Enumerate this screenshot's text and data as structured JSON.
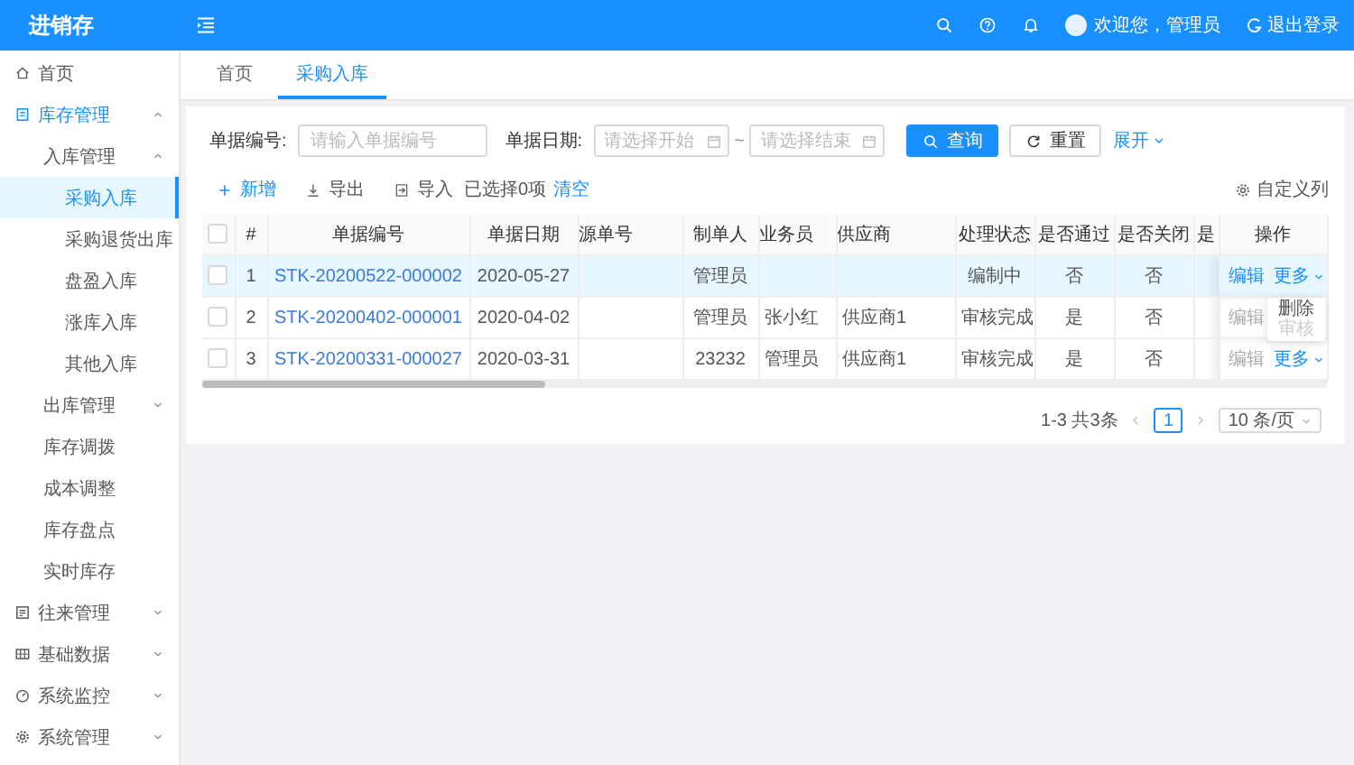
{
  "app": {
    "title": "进销存",
    "user": "欢迎您，管理员",
    "logout": "退出登录"
  },
  "sidebar": {
    "items": [
      {
        "label": "首页",
        "selected": false
      },
      {
        "label": "库存管理",
        "selected": false,
        "expanded": true,
        "children": [
          {
            "label": "入库管理",
            "selected": false,
            "expanded": true,
            "children": [
              {
                "label": "采购入库",
                "selected": true
              },
              {
                "label": "采购退货出库",
                "selected": false
              },
              {
                "label": "盘盈入库",
                "selected": false
              },
              {
                "label": "涨库入库",
                "selected": false
              },
              {
                "label": "其他入库",
                "selected": false
              }
            ]
          },
          {
            "label": "出库管理",
            "selected": false,
            "expanded": false
          },
          {
            "label": "库存调拨",
            "selected": false
          },
          {
            "label": "成本调整",
            "selected": false
          },
          {
            "label": "库存盘点",
            "selected": false
          },
          {
            "label": "实时库存",
            "selected": false
          }
        ]
      },
      {
        "label": "往来管理",
        "selected": false,
        "expanded": false
      },
      {
        "label": "基础数据",
        "selected": false,
        "expanded": false
      },
      {
        "label": "系统监控",
        "selected": false,
        "expanded": false
      },
      {
        "label": "系统管理",
        "selected": false,
        "expanded": false
      }
    ]
  },
  "tabs": [
    {
      "label": "首页",
      "selected": false
    },
    {
      "label": "采购入库",
      "selected": true
    }
  ],
  "search_form": {
    "fields": [
      {
        "kind": "text",
        "label": "单据编号:",
        "placeholder": "请输入单据编号"
      },
      {
        "kind": "range",
        "label": "单据日期:",
        "placeholder": "请选择开始",
        "separator": "~",
        "placeholder_end": "请选择结束"
      }
    ],
    "buttons": [
      {
        "kind": "primary",
        "label": "查询"
      },
      {
        "kind": "default",
        "label": "重置"
      }
    ],
    "expand": "展开"
  },
  "toolbar": {
    "actions": [
      {
        "kind": "add",
        "label": "新增"
      },
      {
        "kind": "export",
        "label": "导出"
      },
      {
        "kind": "import",
        "label": "导入"
      }
    ],
    "selection": "已选择0项",
    "clear": "清空",
    "columns": "自定义列"
  },
  "table": {
    "header_checked": false,
    "columns": [
      "#",
      "单据编号",
      "单据日期",
      "源单号",
      "制单人",
      "业务员",
      "供应商",
      "处理状态",
      "是否通过",
      "是否关闭",
      "是",
      "操作"
    ],
    "rows": [
      {
        "checked": false,
        "highlighted": true,
        "cells": [
          "1",
          "STK-20200522-000002",
          "2020-05-27",
          "",
          "管理员",
          "",
          "",
          "编制中",
          "否",
          "否",
          ""
        ],
        "edit": "编辑",
        "edit_disabled": false,
        "more": "更多"
      },
      {
        "checked": false,
        "highlighted": false,
        "cells": [
          "2",
          "STK-20200402-000001",
          "2020-04-02",
          "",
          "管理员",
          "张小红",
          "供应商1",
          "审核完成",
          "是",
          "否",
          ""
        ],
        "edit": "编辑",
        "edit_disabled": true,
        "menu": [
          {
            "label": "删除",
            "disabled": false
          },
          {
            "label": "审核",
            "disabled": true
          }
        ]
      },
      {
        "checked": false,
        "highlighted": false,
        "cells": [
          "3",
          "STK-20200331-000027",
          "2020-03-31",
          "",
          "23232",
          "管理员",
          "供应商1",
          "审核完成",
          "是",
          "否",
          ""
        ],
        "edit": "编辑",
        "edit_disabled": true,
        "more": "更多"
      }
    ]
  },
  "pagination": {
    "summary": "1-3 共3条",
    "pages": [
      {
        "label": "1",
        "selected": true
      }
    ],
    "page_size": "10 条/页"
  }
}
